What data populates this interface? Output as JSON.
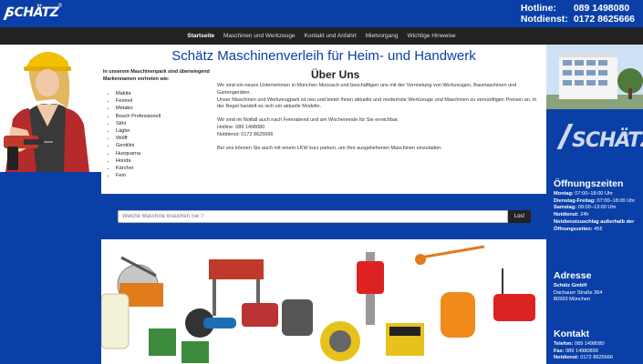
{
  "header": {
    "logo_text": "SCHÄTZ",
    "logo_reg": "®",
    "hotline_label": "Hotline:",
    "hotline_number": "089 1498080",
    "notdienst_label": "Notdienst:",
    "notdienst_number": "0172 8625666"
  },
  "nav": {
    "items": [
      {
        "label": "Startseite",
        "active": true
      },
      {
        "label": "Maschinen und Werkzeuge"
      },
      {
        "label": "Kontakt und Anfahrt"
      },
      {
        "label": "Mietvorgang"
      },
      {
        "label": "Wichtige Hinweise"
      }
    ]
  },
  "main": {
    "title": "Schätz Maschinenverleih für Heim- und Handwerk",
    "brands_intro": "In unserem Maschinenpark sind überwiegend Markennamen vertreten wie:",
    "brands": [
      "Makita",
      "Festool",
      "Metabo",
      "Bosch Professionell",
      "Stihl",
      "Lägler",
      "Wolff",
      "Gentilini",
      "Husqvarna",
      "Honda",
      "Kärcher",
      "Fein"
    ],
    "about_title": "Über Uns",
    "about_p1": "Wir sind ein neues Unternehmen in München Moosach und beschäftigen uns mit der Vermietung von Werkzeugen, Baumaschinen und Gartengeräten.",
    "about_p1b": "Unser Maschinen und Werkzeugpark ist neu und bietet Ihnen aktuelle und modernste Werkzeuge und Maschinen zu vernünftigen Preisen an. In der Regel handelt es sich um aktuelle Modelle.",
    "about_p2": "Wir sind im Notfall auch nach Feierabend und am Wochenende für Sie erreichbar.",
    "about_hotline": "Hotline: 089 1498080",
    "about_notdienst": "Notdienst: 0172 8625666",
    "about_p3": "Bei uns können Sie auch mit einem LKW kurz parken, um Ihre ausgeliehenen Maschinen einzuladen."
  },
  "search": {
    "placeholder": "Welche Maschine brauchen Sie ?",
    "button_label": "Los!"
  },
  "sidebar": {
    "logo_text": "SCHÄTZ",
    "logo_reg": "®",
    "hours_title": "Öffnungszeiten",
    "hours": [
      {
        "label": "Montag:",
        "value": " 07:00–18:00 Uhr"
      },
      {
        "label": "Dienstag-Freitag:",
        "value": " 07:00–18:00 Uhr"
      },
      {
        "label": "Samstag:",
        "value": " 09:00–13:00 Uhr"
      },
      {
        "label": "Notdienst:",
        "value": " 24h"
      },
      {
        "label": "Notdienstzuschlag außerhalb der Öffnungszeiten:",
        "value": " 45€"
      }
    ],
    "address_title": "Adresse",
    "company": "Schätz GmbH",
    "street": "Dachauer Straße 364",
    "city": "80993 München",
    "contact_title": "Kontakt",
    "phone_label": "Telefon:",
    "phone": " 089 1498080",
    "fax_label": "Fax:",
    "fax": " 089 14980899",
    "notdienst_label": "Notdienst:",
    "notdienst": " 0172 8625666"
  },
  "colors": {
    "brand_blue": "#0a3fa8",
    "nav_dark": "#222222"
  }
}
